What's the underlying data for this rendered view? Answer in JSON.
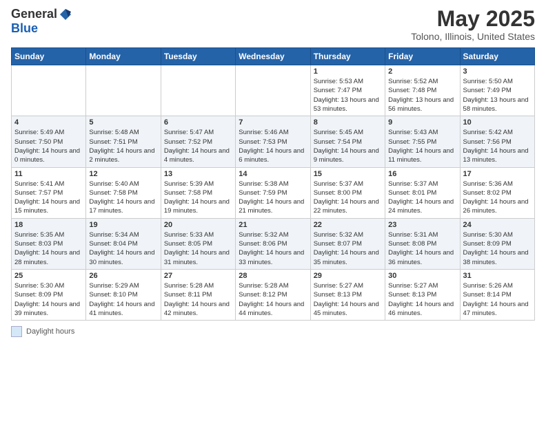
{
  "header": {
    "logo_general": "General",
    "logo_blue": "Blue",
    "title": "May 2025",
    "subtitle": "Tolono, Illinois, United States"
  },
  "calendar": {
    "days_of_week": [
      "Sunday",
      "Monday",
      "Tuesday",
      "Wednesday",
      "Thursday",
      "Friday",
      "Saturday"
    ],
    "weeks": [
      [
        {
          "day": "",
          "sunrise": "",
          "sunset": "",
          "daylight": ""
        },
        {
          "day": "",
          "sunrise": "",
          "sunset": "",
          "daylight": ""
        },
        {
          "day": "",
          "sunrise": "",
          "sunset": "",
          "daylight": ""
        },
        {
          "day": "",
          "sunrise": "",
          "sunset": "",
          "daylight": ""
        },
        {
          "day": "1",
          "sunrise": "Sunrise: 5:53 AM",
          "sunset": "Sunset: 7:47 PM",
          "daylight": "Daylight: 13 hours and 53 minutes."
        },
        {
          "day": "2",
          "sunrise": "Sunrise: 5:52 AM",
          "sunset": "Sunset: 7:48 PM",
          "daylight": "Daylight: 13 hours and 56 minutes."
        },
        {
          "day": "3",
          "sunrise": "Sunrise: 5:50 AM",
          "sunset": "Sunset: 7:49 PM",
          "daylight": "Daylight: 13 hours and 58 minutes."
        }
      ],
      [
        {
          "day": "4",
          "sunrise": "Sunrise: 5:49 AM",
          "sunset": "Sunset: 7:50 PM",
          "daylight": "Daylight: 14 hours and 0 minutes."
        },
        {
          "day": "5",
          "sunrise": "Sunrise: 5:48 AM",
          "sunset": "Sunset: 7:51 PM",
          "daylight": "Daylight: 14 hours and 2 minutes."
        },
        {
          "day": "6",
          "sunrise": "Sunrise: 5:47 AM",
          "sunset": "Sunset: 7:52 PM",
          "daylight": "Daylight: 14 hours and 4 minutes."
        },
        {
          "day": "7",
          "sunrise": "Sunrise: 5:46 AM",
          "sunset": "Sunset: 7:53 PM",
          "daylight": "Daylight: 14 hours and 6 minutes."
        },
        {
          "day": "8",
          "sunrise": "Sunrise: 5:45 AM",
          "sunset": "Sunset: 7:54 PM",
          "daylight": "Daylight: 14 hours and 9 minutes."
        },
        {
          "day": "9",
          "sunrise": "Sunrise: 5:43 AM",
          "sunset": "Sunset: 7:55 PM",
          "daylight": "Daylight: 14 hours and 11 minutes."
        },
        {
          "day": "10",
          "sunrise": "Sunrise: 5:42 AM",
          "sunset": "Sunset: 7:56 PM",
          "daylight": "Daylight: 14 hours and 13 minutes."
        }
      ],
      [
        {
          "day": "11",
          "sunrise": "Sunrise: 5:41 AM",
          "sunset": "Sunset: 7:57 PM",
          "daylight": "Daylight: 14 hours and 15 minutes."
        },
        {
          "day": "12",
          "sunrise": "Sunrise: 5:40 AM",
          "sunset": "Sunset: 7:58 PM",
          "daylight": "Daylight: 14 hours and 17 minutes."
        },
        {
          "day": "13",
          "sunrise": "Sunrise: 5:39 AM",
          "sunset": "Sunset: 7:58 PM",
          "daylight": "Daylight: 14 hours and 19 minutes."
        },
        {
          "day": "14",
          "sunrise": "Sunrise: 5:38 AM",
          "sunset": "Sunset: 7:59 PM",
          "daylight": "Daylight: 14 hours and 21 minutes."
        },
        {
          "day": "15",
          "sunrise": "Sunrise: 5:37 AM",
          "sunset": "Sunset: 8:00 PM",
          "daylight": "Daylight: 14 hours and 22 minutes."
        },
        {
          "day": "16",
          "sunrise": "Sunrise: 5:37 AM",
          "sunset": "Sunset: 8:01 PM",
          "daylight": "Daylight: 14 hours and 24 minutes."
        },
        {
          "day": "17",
          "sunrise": "Sunrise: 5:36 AM",
          "sunset": "Sunset: 8:02 PM",
          "daylight": "Daylight: 14 hours and 26 minutes."
        }
      ],
      [
        {
          "day": "18",
          "sunrise": "Sunrise: 5:35 AM",
          "sunset": "Sunset: 8:03 PM",
          "daylight": "Daylight: 14 hours and 28 minutes."
        },
        {
          "day": "19",
          "sunrise": "Sunrise: 5:34 AM",
          "sunset": "Sunset: 8:04 PM",
          "daylight": "Daylight: 14 hours and 30 minutes."
        },
        {
          "day": "20",
          "sunrise": "Sunrise: 5:33 AM",
          "sunset": "Sunset: 8:05 PM",
          "daylight": "Daylight: 14 hours and 31 minutes."
        },
        {
          "day": "21",
          "sunrise": "Sunrise: 5:32 AM",
          "sunset": "Sunset: 8:06 PM",
          "daylight": "Daylight: 14 hours and 33 minutes."
        },
        {
          "day": "22",
          "sunrise": "Sunrise: 5:32 AM",
          "sunset": "Sunset: 8:07 PM",
          "daylight": "Daylight: 14 hours and 35 minutes."
        },
        {
          "day": "23",
          "sunrise": "Sunrise: 5:31 AM",
          "sunset": "Sunset: 8:08 PM",
          "daylight": "Daylight: 14 hours and 36 minutes."
        },
        {
          "day": "24",
          "sunrise": "Sunrise: 5:30 AM",
          "sunset": "Sunset: 8:09 PM",
          "daylight": "Daylight: 14 hours and 38 minutes."
        }
      ],
      [
        {
          "day": "25",
          "sunrise": "Sunrise: 5:30 AM",
          "sunset": "Sunset: 8:09 PM",
          "daylight": "Daylight: 14 hours and 39 minutes."
        },
        {
          "day": "26",
          "sunrise": "Sunrise: 5:29 AM",
          "sunset": "Sunset: 8:10 PM",
          "daylight": "Daylight: 14 hours and 41 minutes."
        },
        {
          "day": "27",
          "sunrise": "Sunrise: 5:28 AM",
          "sunset": "Sunset: 8:11 PM",
          "daylight": "Daylight: 14 hours and 42 minutes."
        },
        {
          "day": "28",
          "sunrise": "Sunrise: 5:28 AM",
          "sunset": "Sunset: 8:12 PM",
          "daylight": "Daylight: 14 hours and 44 minutes."
        },
        {
          "day": "29",
          "sunrise": "Sunrise: 5:27 AM",
          "sunset": "Sunset: 8:13 PM",
          "daylight": "Daylight: 14 hours and 45 minutes."
        },
        {
          "day": "30",
          "sunrise": "Sunrise: 5:27 AM",
          "sunset": "Sunset: 8:13 PM",
          "daylight": "Daylight: 14 hours and 46 minutes."
        },
        {
          "day": "31",
          "sunrise": "Sunrise: 5:26 AM",
          "sunset": "Sunset: 8:14 PM",
          "daylight": "Daylight: 14 hours and 47 minutes."
        }
      ]
    ]
  },
  "legend": {
    "label": "Daylight hours"
  }
}
